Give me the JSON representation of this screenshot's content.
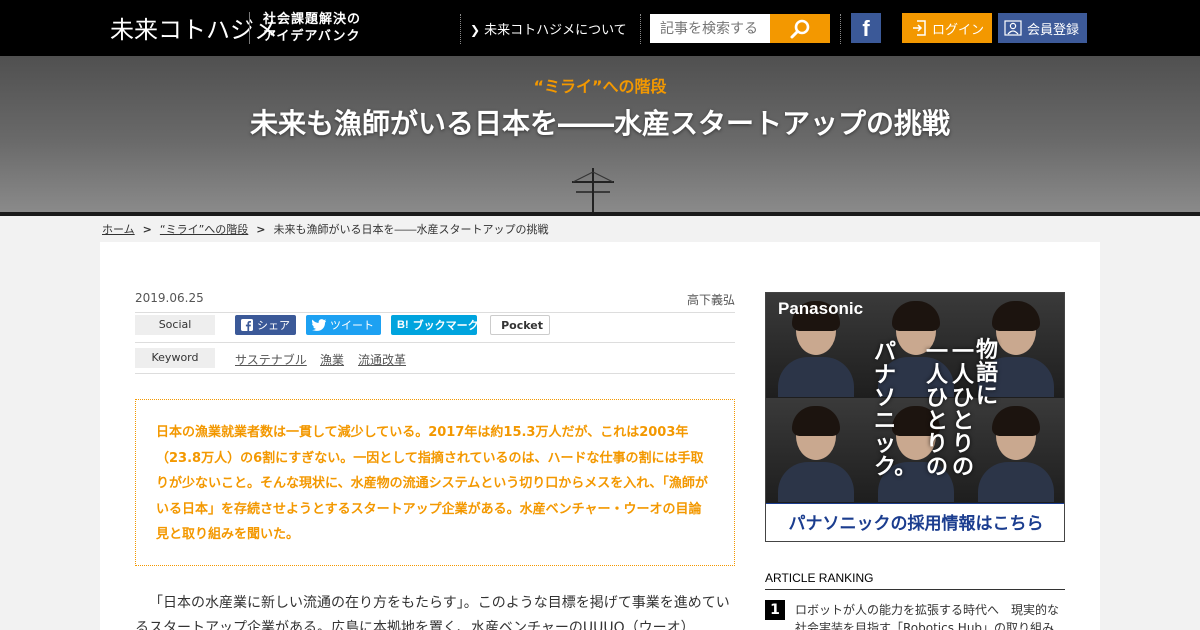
{
  "header": {
    "logo_text": "未来コトハジメ",
    "logo_subtitle_line1": "社会課題解決の",
    "logo_subtitle_line2": "アイデアバンク",
    "about_link": "未来コトハジメについて",
    "search_placeholder": "記事を検索する",
    "facebook_label": "f",
    "login_label": "ログイン",
    "register_label": "会員登録",
    "colors": {
      "bar": "#000000",
      "accent": "#f39800",
      "facebook": "#3b5998",
      "register": "#3d5a99"
    }
  },
  "hero": {
    "category": "“ミライ”への階段",
    "title": "未来も漁師がいる日本を――水産スタートアップの挑戦"
  },
  "breadcrumb": {
    "home": "ホーム",
    "category": "“ミライ”への階段",
    "current": "未来も漁師がいる日本を――水産スタートアップの挑戦"
  },
  "article": {
    "date": "2019.06.25",
    "author": "高下義弘",
    "social_label": "Social",
    "share_facebook": "シェア",
    "share_twitter": "ツイート",
    "share_hatena": "ブックマーク",
    "share_pocket": "Pocket",
    "keyword_label": "Keyword",
    "keywords": [
      "サステナブル",
      "漁業",
      "流通改革"
    ],
    "lead": "日本の漁業就業者数は一貫して減少している。2017年は約15.3万人だが、これは2003年（23.8万人）の6割にすぎない。一因として指摘されているのは、ハードな仕事の割には手取りが少ないこと。そんな現状に、水産物の流通システムという切り口からメスを入れ、「漁師がいる日本」を存続させようとするスタートアップ企業がある。水産ベンチャー・ウーオの目論見と取り組みを聞いた。",
    "body": "「日本の水産業に新しい流通の在り方をもたらす」。このような目標を掲げて事業を進めているスタートアップ企業がある。広島に本拠地を置く、水産ベンチャーのUUUO（ウーオ）"
  },
  "sidebar": {
    "ad": {
      "brand": "Panasonic",
      "copy_col1": "物語に",
      "copy_col2": "一人ひとりの",
      "copy_col3": "一人ひとりの",
      "copy_col4": "パナソニック。",
      "cta": "パナソニックの採用情報はこちら"
    },
    "ranking": {
      "heading": "ARTICLE RANKING",
      "items": [
        {
          "rank": "1",
          "title": "ロボットが人の能力を拡張する時代へ　現実的な社会実装を目指す「Robotics Hub」の取り組み"
        }
      ]
    }
  }
}
